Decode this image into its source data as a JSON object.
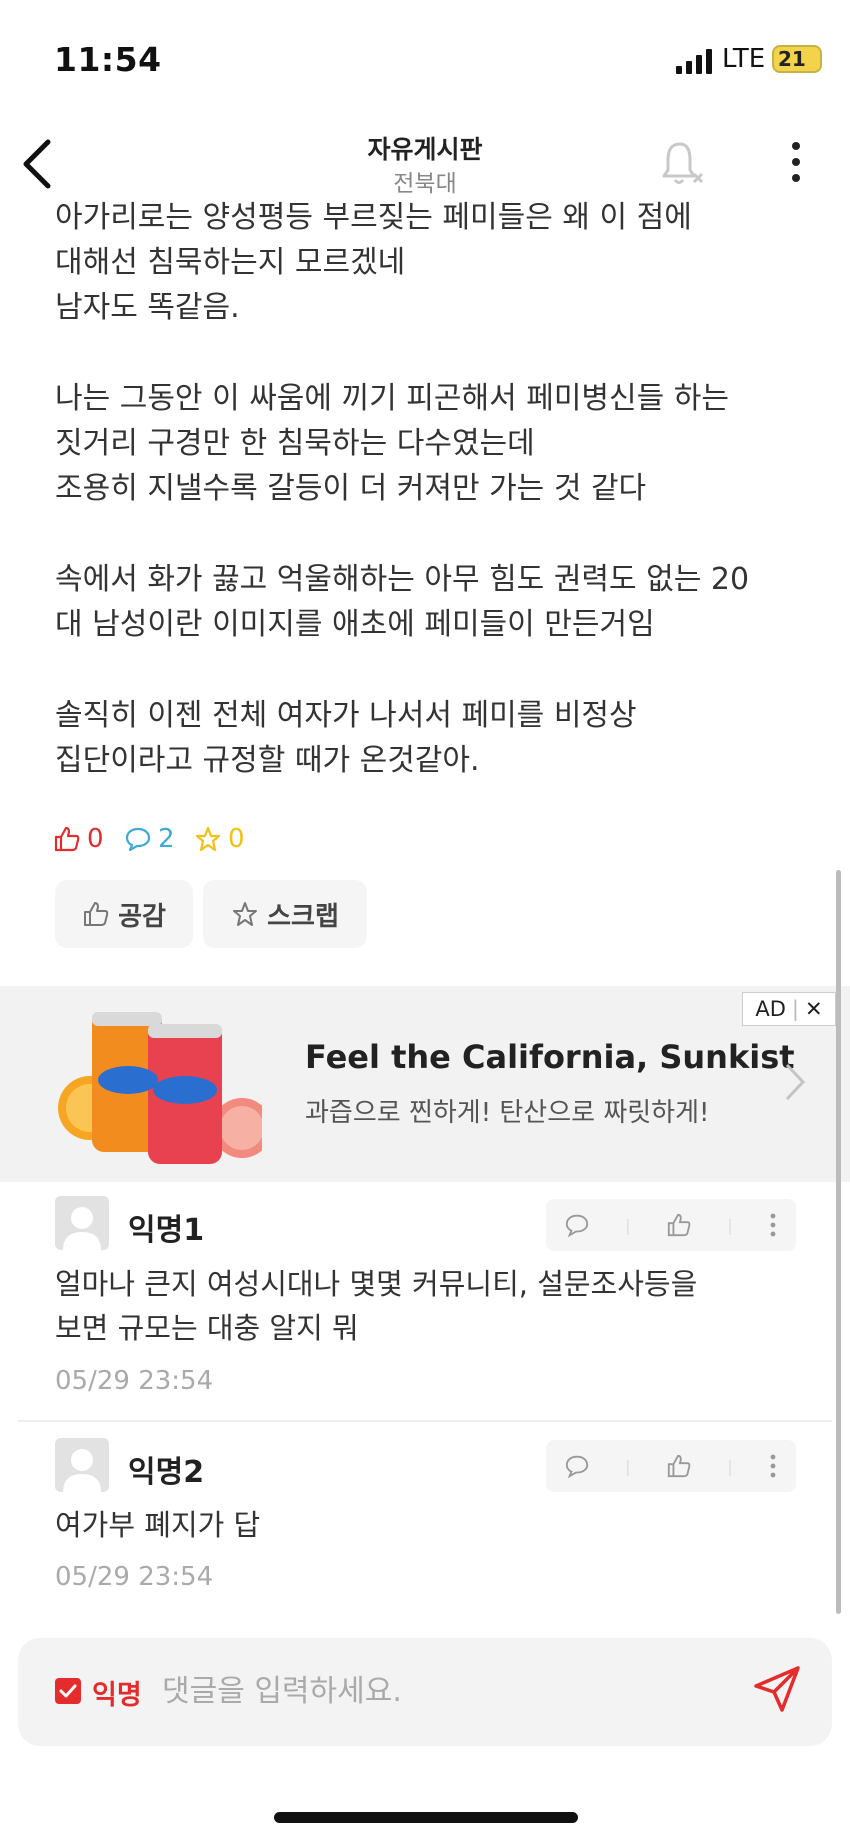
{
  "status": {
    "time": "11:54",
    "network": "LTE",
    "battery": "21"
  },
  "header": {
    "title": "자유게시판",
    "subtitle": "전북대"
  },
  "post": {
    "lines": [
      "아가리로는 양성평등 부르짖는 페미들은 왜 이 점에",
      "대해선 침묵하는지 모르겠네",
      "남자도 똑같음.",
      "",
      "나는 그동안 이 싸움에 끼기 피곤해서 페미병신들 하는",
      "짓거리 구경만 한 침묵하는 다수였는데",
      "조용히 지낼수록 갈등이 더 커져만 가는 것 같다",
      "",
      "속에서 화가 끓고 억울해하는 아무 힘도 권력도 없는 20",
      "대 남성이란 이미지를 애초에 페미들이 만든거임",
      "",
      "솔직히 이젠 전체 여자가 나서서 페미를 비정상",
      "집단이라고 규정할 때가 온것같아."
    ],
    "stats": {
      "likes": "0",
      "comments": "2",
      "scraps": "0"
    },
    "buttons": {
      "like": "공감",
      "scrap": "스크랩"
    }
  },
  "ad": {
    "badge": "AD",
    "title": "Feel the California, Sunkist",
    "subtitle": "과즙으로 찐하게! 탄산으로 짜릿하게!",
    "brand": "Sunkist"
  },
  "comments": [
    {
      "author": "익명1",
      "lines": [
        "얼마나 큰지 여성시대나 몇몇 커뮤니티, 설문조사등을",
        "보면 규모는 대충 알지 뭐"
      ],
      "time": "05/29 23:54"
    },
    {
      "author": "익명2",
      "lines": [
        "여가부 폐지가 답"
      ],
      "time": "05/29 23:54"
    }
  ],
  "input": {
    "anonymous_label": "익명",
    "placeholder": "댓글을 입력하세요."
  },
  "colors": {
    "accent_red": "#e52c2c",
    "comment_blue": "#3fa9d8",
    "scrap_yellow": "#f3c014"
  }
}
